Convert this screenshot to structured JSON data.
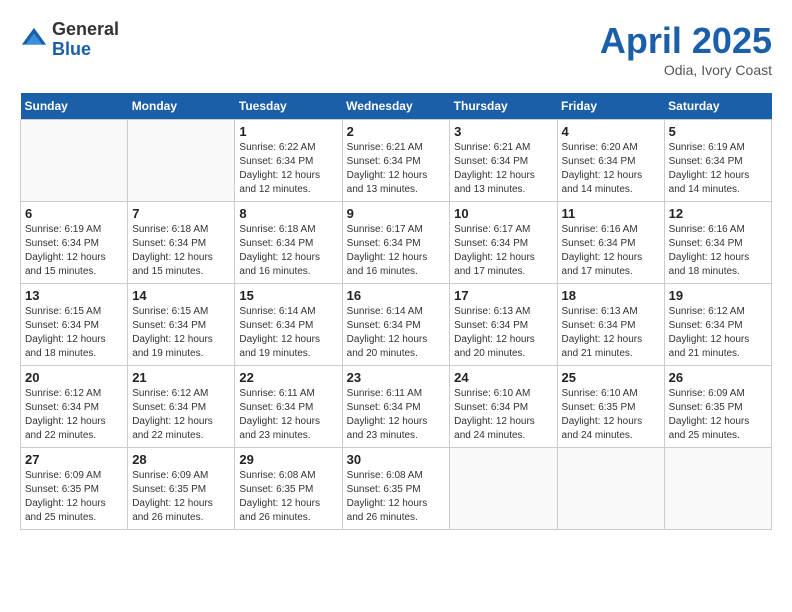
{
  "header": {
    "logo_general": "General",
    "logo_blue": "Blue",
    "month_title": "April 2025",
    "location": "Odia, Ivory Coast"
  },
  "calendar": {
    "weekdays": [
      "Sunday",
      "Monday",
      "Tuesday",
      "Wednesday",
      "Thursday",
      "Friday",
      "Saturday"
    ],
    "weeks": [
      [
        {
          "day": "",
          "info": ""
        },
        {
          "day": "",
          "info": ""
        },
        {
          "day": "1",
          "info": "Sunrise: 6:22 AM\nSunset: 6:34 PM\nDaylight: 12 hours\nand 12 minutes."
        },
        {
          "day": "2",
          "info": "Sunrise: 6:21 AM\nSunset: 6:34 PM\nDaylight: 12 hours\nand 13 minutes."
        },
        {
          "day": "3",
          "info": "Sunrise: 6:21 AM\nSunset: 6:34 PM\nDaylight: 12 hours\nand 13 minutes."
        },
        {
          "day": "4",
          "info": "Sunrise: 6:20 AM\nSunset: 6:34 PM\nDaylight: 12 hours\nand 14 minutes."
        },
        {
          "day": "5",
          "info": "Sunrise: 6:19 AM\nSunset: 6:34 PM\nDaylight: 12 hours\nand 14 minutes."
        }
      ],
      [
        {
          "day": "6",
          "info": "Sunrise: 6:19 AM\nSunset: 6:34 PM\nDaylight: 12 hours\nand 15 minutes."
        },
        {
          "day": "7",
          "info": "Sunrise: 6:18 AM\nSunset: 6:34 PM\nDaylight: 12 hours\nand 15 minutes."
        },
        {
          "day": "8",
          "info": "Sunrise: 6:18 AM\nSunset: 6:34 PM\nDaylight: 12 hours\nand 16 minutes."
        },
        {
          "day": "9",
          "info": "Sunrise: 6:17 AM\nSunset: 6:34 PM\nDaylight: 12 hours\nand 16 minutes."
        },
        {
          "day": "10",
          "info": "Sunrise: 6:17 AM\nSunset: 6:34 PM\nDaylight: 12 hours\nand 17 minutes."
        },
        {
          "day": "11",
          "info": "Sunrise: 6:16 AM\nSunset: 6:34 PM\nDaylight: 12 hours\nand 17 minutes."
        },
        {
          "day": "12",
          "info": "Sunrise: 6:16 AM\nSunset: 6:34 PM\nDaylight: 12 hours\nand 18 minutes."
        }
      ],
      [
        {
          "day": "13",
          "info": "Sunrise: 6:15 AM\nSunset: 6:34 PM\nDaylight: 12 hours\nand 18 minutes."
        },
        {
          "day": "14",
          "info": "Sunrise: 6:15 AM\nSunset: 6:34 PM\nDaylight: 12 hours\nand 19 minutes."
        },
        {
          "day": "15",
          "info": "Sunrise: 6:14 AM\nSunset: 6:34 PM\nDaylight: 12 hours\nand 19 minutes."
        },
        {
          "day": "16",
          "info": "Sunrise: 6:14 AM\nSunset: 6:34 PM\nDaylight: 12 hours\nand 20 minutes."
        },
        {
          "day": "17",
          "info": "Sunrise: 6:13 AM\nSunset: 6:34 PM\nDaylight: 12 hours\nand 20 minutes."
        },
        {
          "day": "18",
          "info": "Sunrise: 6:13 AM\nSunset: 6:34 PM\nDaylight: 12 hours\nand 21 minutes."
        },
        {
          "day": "19",
          "info": "Sunrise: 6:12 AM\nSunset: 6:34 PM\nDaylight: 12 hours\nand 21 minutes."
        }
      ],
      [
        {
          "day": "20",
          "info": "Sunrise: 6:12 AM\nSunset: 6:34 PM\nDaylight: 12 hours\nand 22 minutes."
        },
        {
          "day": "21",
          "info": "Sunrise: 6:12 AM\nSunset: 6:34 PM\nDaylight: 12 hours\nand 22 minutes."
        },
        {
          "day": "22",
          "info": "Sunrise: 6:11 AM\nSunset: 6:34 PM\nDaylight: 12 hours\nand 23 minutes."
        },
        {
          "day": "23",
          "info": "Sunrise: 6:11 AM\nSunset: 6:34 PM\nDaylight: 12 hours\nand 23 minutes."
        },
        {
          "day": "24",
          "info": "Sunrise: 6:10 AM\nSunset: 6:34 PM\nDaylight: 12 hours\nand 24 minutes."
        },
        {
          "day": "25",
          "info": "Sunrise: 6:10 AM\nSunset: 6:35 PM\nDaylight: 12 hours\nand 24 minutes."
        },
        {
          "day": "26",
          "info": "Sunrise: 6:09 AM\nSunset: 6:35 PM\nDaylight: 12 hours\nand 25 minutes."
        }
      ],
      [
        {
          "day": "27",
          "info": "Sunrise: 6:09 AM\nSunset: 6:35 PM\nDaylight: 12 hours\nand 25 minutes."
        },
        {
          "day": "28",
          "info": "Sunrise: 6:09 AM\nSunset: 6:35 PM\nDaylight: 12 hours\nand 26 minutes."
        },
        {
          "day": "29",
          "info": "Sunrise: 6:08 AM\nSunset: 6:35 PM\nDaylight: 12 hours\nand 26 minutes."
        },
        {
          "day": "30",
          "info": "Sunrise: 6:08 AM\nSunset: 6:35 PM\nDaylight: 12 hours\nand 26 minutes."
        },
        {
          "day": "",
          "info": ""
        },
        {
          "day": "",
          "info": ""
        },
        {
          "day": "",
          "info": ""
        }
      ]
    ]
  }
}
